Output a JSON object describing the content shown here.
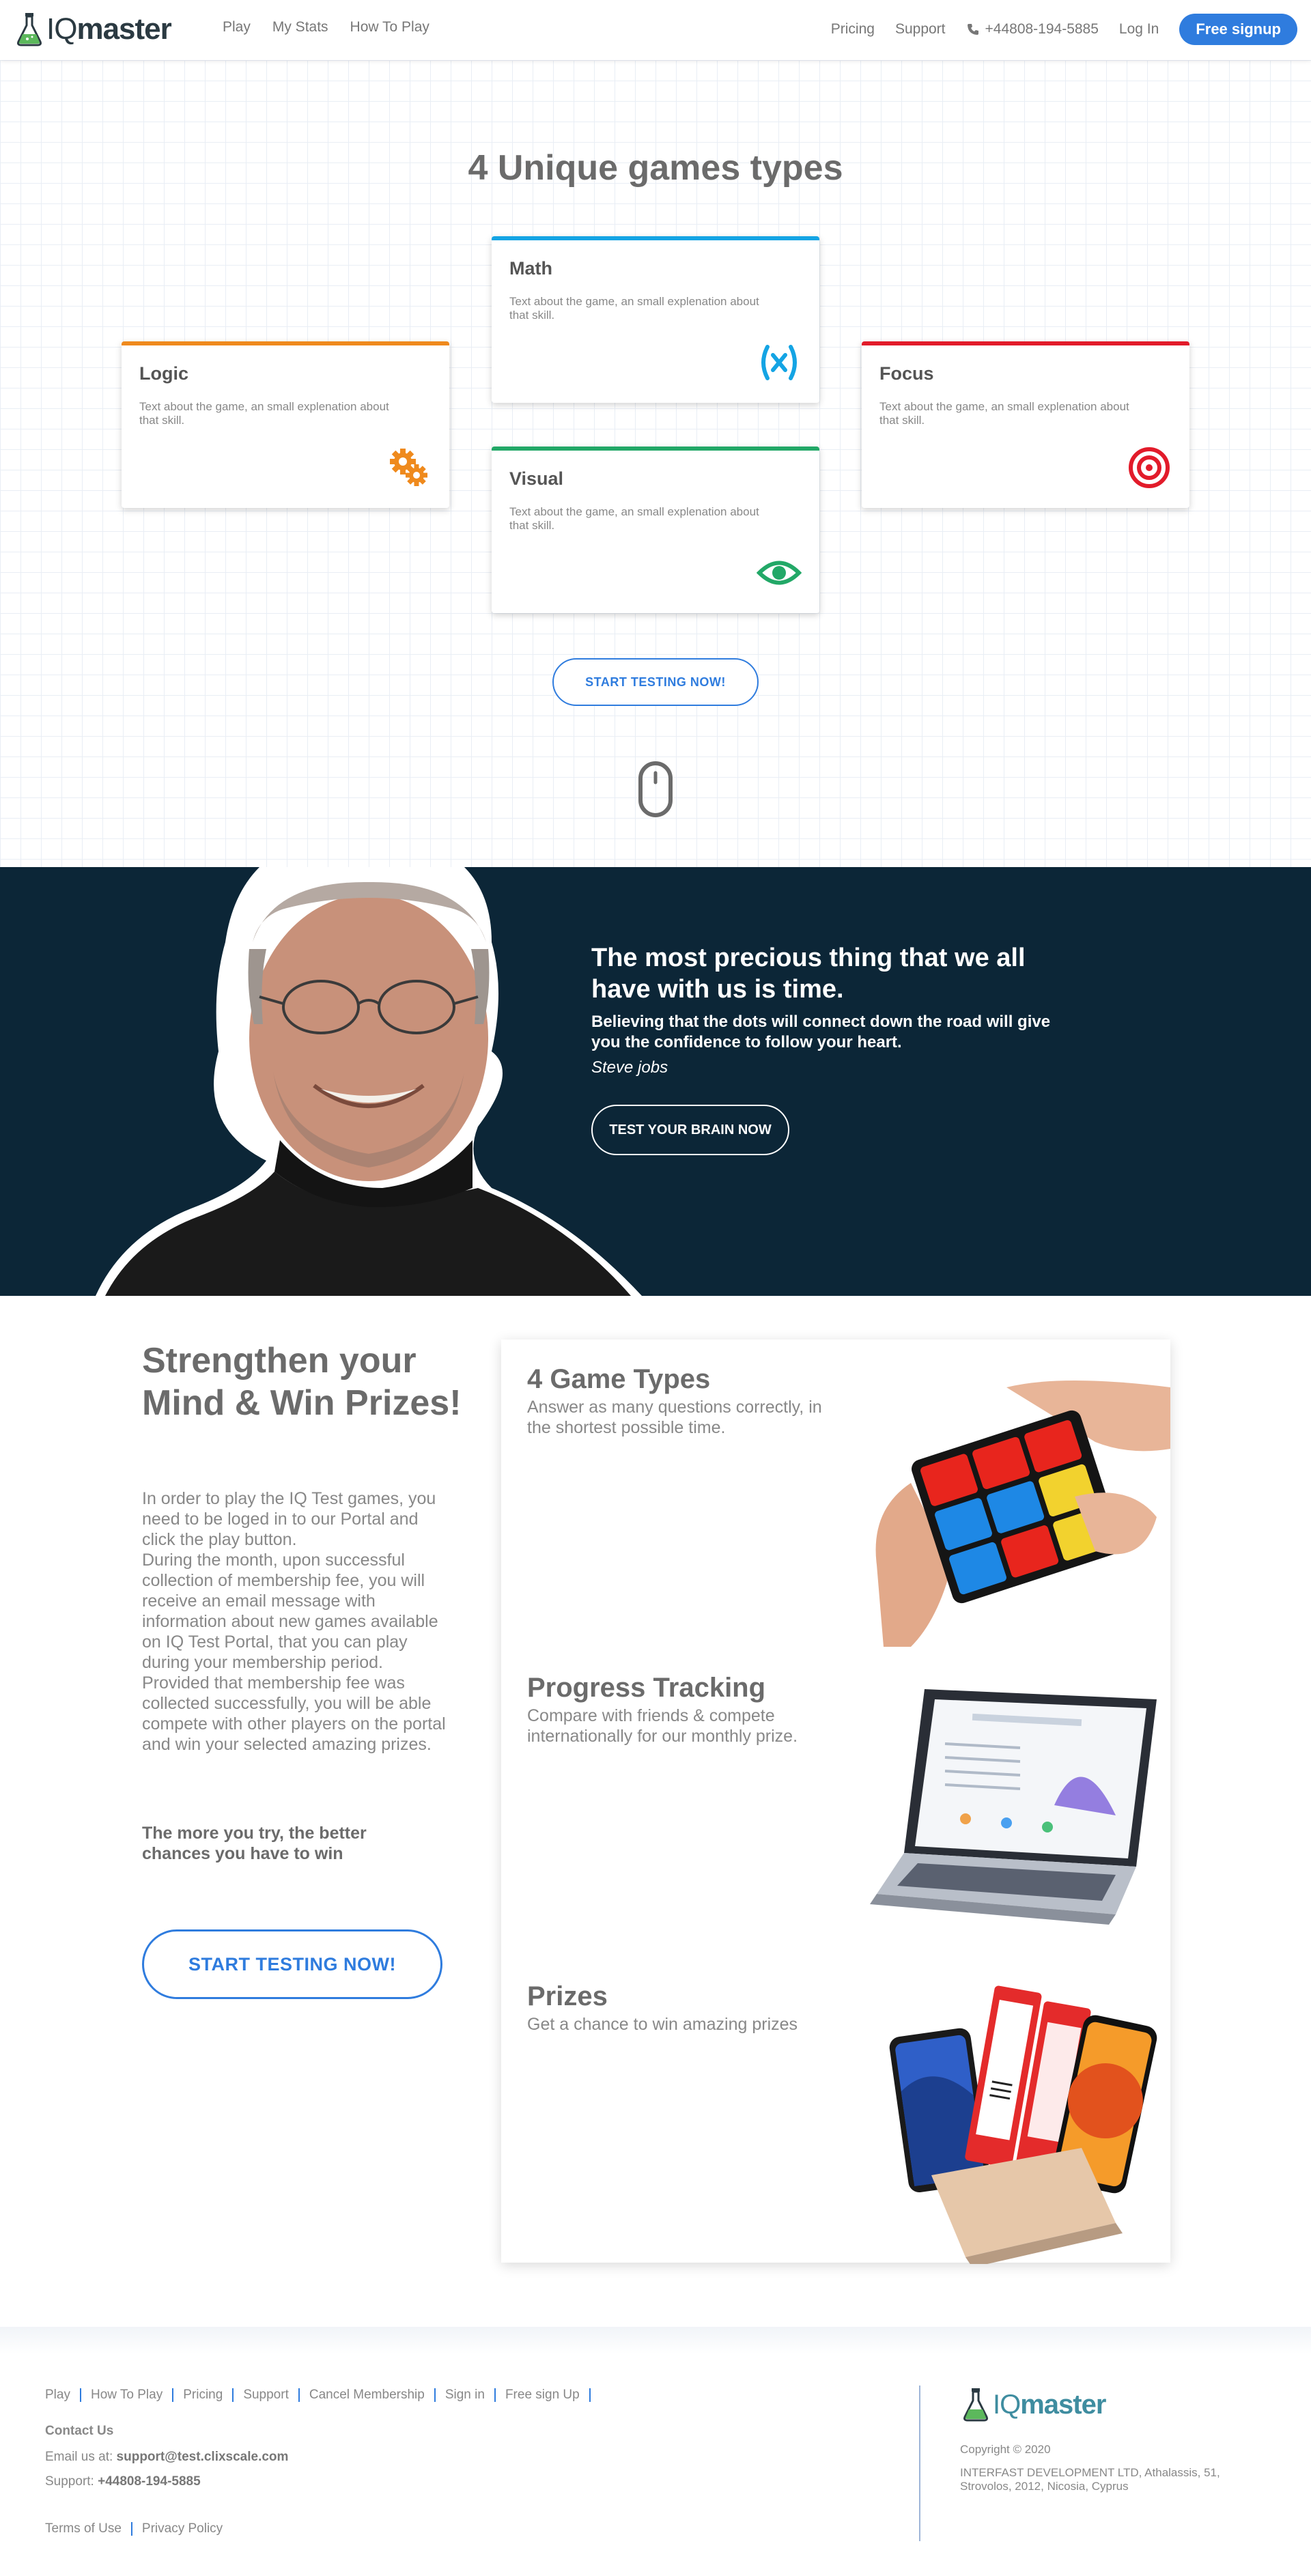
{
  "header": {
    "logo_prefix": "IQ",
    "logo_suffix": "master",
    "nav_left": [
      "Play",
      "My Stats",
      "How To Play"
    ],
    "pricing": "Pricing",
    "support": "Support",
    "phone": "+44808-194-5885",
    "login": "Log In",
    "signup": "Free signup"
  },
  "hero": {
    "title": "4 Unique games types",
    "cards": {
      "math": {
        "title": "Math",
        "desc": "Text about the game, an small explenation about that skill.",
        "color": "#14a4e4"
      },
      "logic": {
        "title": "Logic",
        "desc": "Text about the game, an small explenation about that skill.",
        "color": "#ef8a1d"
      },
      "focus": {
        "title": "Focus",
        "desc": "Text about the game, an small explenation about that skill.",
        "color": "#e21b2a"
      },
      "visual": {
        "title": "Visual",
        "desc": "Text about the game, an small explenation about that skill.",
        "color": "#22a867"
      }
    },
    "cta": "START TESTING NOW!"
  },
  "quote": {
    "headline": "The most precious thing that we all have with us is time.",
    "sub": "Believing that the dots will connect down the road will give you the confidence to follow your heart.",
    "author": "Steve jobs",
    "cta": "TEST YOUR BRAIN NOW"
  },
  "strength": {
    "title": "Strengthen your Mind & Win Prizes!",
    "body1": "In order to play the IQ Test games, you need to be loged in to our Portal and click the play button.",
    "body2": "During the month, upon successful collection of membership fee, you will receive an email message with information about new games available on IQ Test Portal, that you can play during your membership period.",
    "body3": "Provided that membership fee was collected successfully, you will be able compete with other players on the portal and win your selected amazing prizes.",
    "bold": "The more you try, the better chances you have to win",
    "cta": "START TESTING NOW!",
    "features": [
      {
        "title": "4 Game Types",
        "desc": "Answer as many questions correctly, in the shortest possible time."
      },
      {
        "title": "Progress Tracking",
        "desc": "Compare with friends & compete internationally for our monthly prize."
      },
      {
        "title": "Prizes",
        "desc": "Get a chance to win amazing prizes"
      }
    ]
  },
  "footer": {
    "links": [
      "Play",
      "How To Play",
      "Pricing",
      "Support",
      "Cancel Membership",
      "Sign in",
      "Free sign Up"
    ],
    "contact_heading": "Contact Us",
    "email_label": "Email us at:",
    "email": "support@test.clixscale.com",
    "support_label": "Support:",
    "support_phone": "+44808-194-5885",
    "legal": [
      "Terms of Use",
      "Privacy Policy"
    ],
    "copyright": "Copyright © 2020",
    "address": "INTERFAST DEVELOPMENT LTD, Athalassis, 51, Strovolos, 2012, Nicosia, Cyprus"
  }
}
